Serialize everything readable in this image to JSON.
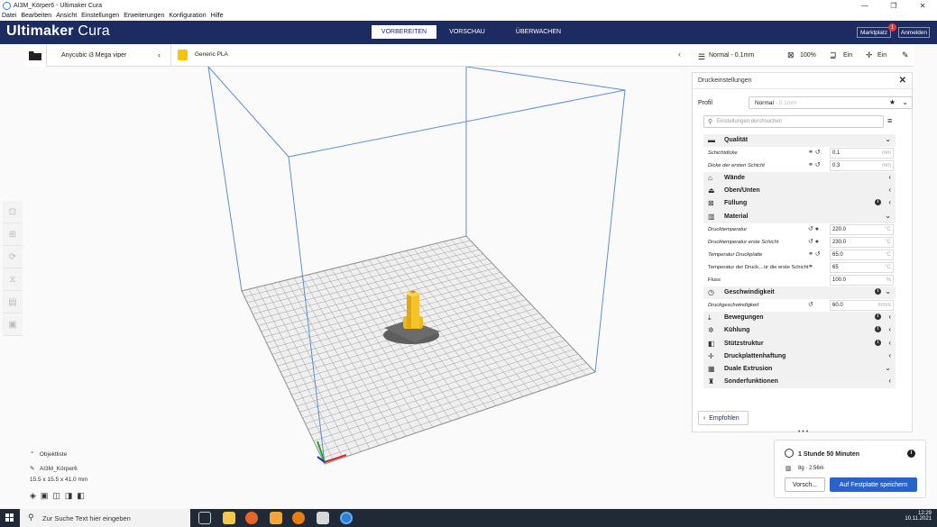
{
  "window": {
    "title": "AI3M_Körper6 - Ultimaker Cura",
    "min": "—",
    "max": "❐",
    "close": "✕"
  },
  "menu": [
    "Datei",
    "Bearbeiten",
    "Ansicht",
    "Einstellungen",
    "Erweiterungen",
    "Konfiguration",
    "Hilfe"
  ],
  "header": {
    "logo_bold": "Ultimaker",
    "logo_light": " Cura",
    "tabs": [
      "VORBEREITEN",
      "VORSCHAU",
      "ÜBERWACHEN"
    ],
    "marketplace": "Marktplatz",
    "marketplace_badge": "1",
    "signin": "Anmelden"
  },
  "printer": {
    "name": "Anycubic i3 Mega viper",
    "chev": "‹"
  },
  "material": {
    "name": "Generic PLA",
    "chev": "‹"
  },
  "setbar": {
    "profile": "Normal - 0.1mm",
    "infill": "100%",
    "support": "Ein",
    "adhesion": "Ein"
  },
  "panel": {
    "title": "Druckeinstellungen",
    "close": "✕",
    "profile_label": "Profil",
    "profile_value": "Normal",
    "profile_suffix": " - 0.1mm",
    "search_placeholder": "Einstellungen durchsuchen",
    "recommended": "Empfohlen",
    "dots": "• • •",
    "items": [
      {
        "kind": "cat",
        "icon": "▬",
        "label": "Qualität",
        "chev": "⌄"
      },
      {
        "kind": "row",
        "label": "Schichtdicke",
        "icons": "⚭ ↺",
        "value": "0.1",
        "unit": "mm"
      },
      {
        "kind": "row",
        "label": "Dicke der ersten Schicht",
        "icons": "⚭ ↺",
        "value": "0.3",
        "unit": "mm"
      },
      {
        "kind": "cat",
        "icon": "⌂",
        "label": "Wände",
        "chev": "‹"
      },
      {
        "kind": "cat",
        "icon": "⏏",
        "label": "Oben/Unten",
        "chev": "‹"
      },
      {
        "kind": "cat",
        "icon": "⊠",
        "label": "Füllung",
        "chev": "‹",
        "info": true
      },
      {
        "kind": "cat",
        "icon": "▥",
        "label": "Material",
        "chev": "⌄"
      },
      {
        "kind": "row",
        "label": "Drucktemperatur",
        "icons": "↺ ●",
        "value": "220.0",
        "unit": "°C"
      },
      {
        "kind": "row",
        "label": "Drucktemperatur erste Schicht",
        "icons": "↺ ●",
        "value": "230.0",
        "unit": "°C"
      },
      {
        "kind": "row",
        "label": "Temperatur Druckplatte",
        "icons": "⚭ ↺",
        "value": "65.0",
        "unit": "°C"
      },
      {
        "kind": "row",
        "plain": true,
        "label": "Temperatur der Druck…ür die erste Schicht",
        "icons": "   ⚭",
        "value": "65",
        "unit": "°C"
      },
      {
        "kind": "row",
        "plain": true,
        "label": "Fluss",
        "icons": "",
        "value": "100.0",
        "unit": "%"
      },
      {
        "kind": "cat",
        "icon": "◷",
        "label": "Geschwindigkeit",
        "chev": "⌄",
        "info": true
      },
      {
        "kind": "row",
        "label": "Druckgeschwindigkeit",
        "icons": "   ↺",
        "value": "60.0",
        "unit": "mm/s"
      },
      {
        "kind": "cat",
        "icon": "⤓",
        "label": "Bewegungen",
        "chev": "‹",
        "info": true
      },
      {
        "kind": "cat",
        "icon": "✲",
        "label": "Kühlung",
        "chev": "‹",
        "info": true
      },
      {
        "kind": "cat",
        "icon": "◧",
        "label": "Stützstruktur",
        "chev": "‹",
        "info": true
      },
      {
        "kind": "cat",
        "icon": "✛",
        "label": "Druckplattenhaftung",
        "chev": "‹"
      },
      {
        "kind": "cat",
        "icon": "▦",
        "label": "Duale Extrusion",
        "chev": "⌄"
      },
      {
        "kind": "cat",
        "icon": "♜",
        "label": "Sonderfunktionen",
        "chev": "‹"
      }
    ]
  },
  "estimate": {
    "time": "1 Stunde 50 Minuten",
    "usage": "8g · 2.56m",
    "preview": "Vorsch...",
    "save": "Auf Festplatte speichern"
  },
  "objects": {
    "header": "Objektliste",
    "name": "AI3M_Körper6",
    "dims": "15.5 x 15.5 x 41.0 mm"
  },
  "taskbar": {
    "search": "Zur Suche Text hier eingeben",
    "time": "12:29",
    "date": "10.11.2021"
  }
}
